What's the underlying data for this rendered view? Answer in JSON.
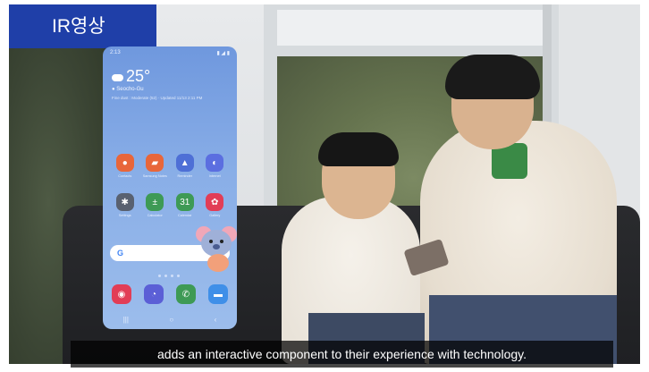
{
  "tag": {
    "label": "IR영상"
  },
  "subtitle": {
    "text": "adds an interactive component to their experience with technology."
  },
  "phone": {
    "status_time": "2:13",
    "status_icons": "▮ ◢ ▮",
    "weather": {
      "temperature": "25°",
      "location": "Seocho-Gu",
      "updated": "Fine dust : Moderate (52) · Updated 11/13 2:11 PM"
    },
    "apps": [
      {
        "label": "Contacts",
        "icon": "person-icon",
        "glyph": "●",
        "color": "#e8663a"
      },
      {
        "label": "Samsung Notes",
        "icon": "note-icon",
        "glyph": "▰",
        "color": "#e8663a"
      },
      {
        "label": "Reminder",
        "icon": "bell-icon",
        "glyph": "▲",
        "color": "#4e6fd6"
      },
      {
        "label": "Internet",
        "icon": "globe-icon",
        "glyph": "◐",
        "color": "#5b6ee0"
      },
      {
        "label": "Settings",
        "icon": "gear-icon",
        "glyph": "✱",
        "color": "#596170"
      },
      {
        "label": "Calculator",
        "icon": "calculator-icon",
        "glyph": "±",
        "color": "#3e9a55"
      },
      {
        "label": "Calendar",
        "icon": "calendar-icon",
        "glyph": "31",
        "color": "#3e9a55"
      },
      {
        "label": "Gallery",
        "icon": "flower-icon",
        "glyph": "✿",
        "color": "#e23d56"
      }
    ],
    "search_glyph": "G",
    "dock": [
      {
        "icon": "camera-icon",
        "glyph": "◉",
        "color": "#e23d56"
      },
      {
        "icon": "clock-icon",
        "glyph": "◔",
        "color": "#5b5fd6"
      },
      {
        "icon": "phone-icon",
        "glyph": "✆",
        "color": "#3e9a55"
      },
      {
        "icon": "message-icon",
        "glyph": "▬",
        "color": "#3f8fe8"
      }
    ],
    "nav": [
      "|||",
      "○",
      "‹"
    ]
  }
}
